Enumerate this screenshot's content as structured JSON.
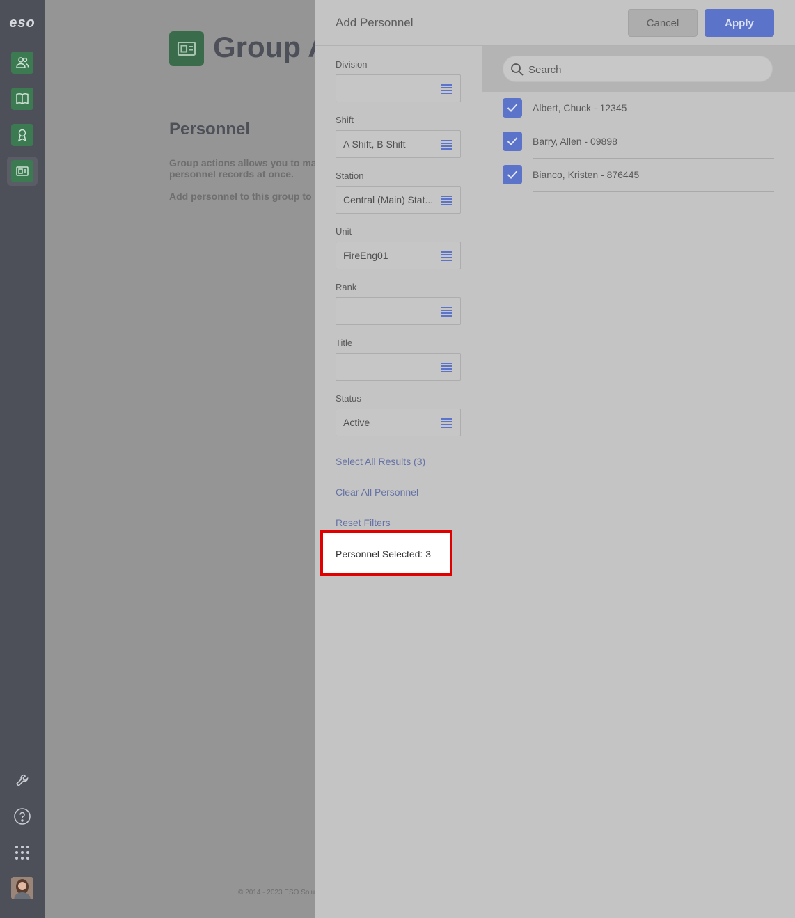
{
  "rail": {
    "logo": "eso",
    "items": [
      {
        "name": "people-icon"
      },
      {
        "name": "book-icon"
      },
      {
        "name": "award-icon"
      },
      {
        "name": "group-actions-icon"
      }
    ],
    "utilities": [
      {
        "name": "wrench-icon"
      },
      {
        "name": "help-icon"
      },
      {
        "name": "apps-grid-icon"
      }
    ]
  },
  "background_page": {
    "title": "Group A",
    "section_title": "Personnel",
    "description_line1": "Group actions allows you to ma",
    "description_line2": "personnel records at once.",
    "description_line3": "Add personnel to this group to",
    "footer": "© 2014 - 2023 ESO Solu"
  },
  "drawer": {
    "title": "Add Personnel",
    "cancel_label": "Cancel",
    "apply_label": "Apply",
    "filters": [
      {
        "label": "Division",
        "value": ""
      },
      {
        "label": "Shift",
        "value": "A Shift, B Shift"
      },
      {
        "label": "Station",
        "value": "Central (Main) Stat..."
      },
      {
        "label": "Unit",
        "value": "FireEng01"
      },
      {
        "label": "Rank",
        "value": ""
      },
      {
        "label": "Title",
        "value": ""
      },
      {
        "label": "Status",
        "value": "Active"
      }
    ],
    "links": {
      "select_all": "Select All Results (3)",
      "clear_all": "Clear All Personnel",
      "reset": "Reset Filters"
    },
    "selected_count": "Personnel Selected: 3",
    "search_placeholder": "Search",
    "results": [
      {
        "label": "Albert, Chuck - 12345",
        "checked": true
      },
      {
        "label": "Barry, Allen - 09898",
        "checked": true
      },
      {
        "label": "Bianco, Kristen - 876445",
        "checked": true
      }
    ]
  },
  "colors": {
    "accent": "#5b73c8",
    "rail": "#4d5058",
    "nav_green": "#3c7a52",
    "highlight_border": "#e00000"
  }
}
